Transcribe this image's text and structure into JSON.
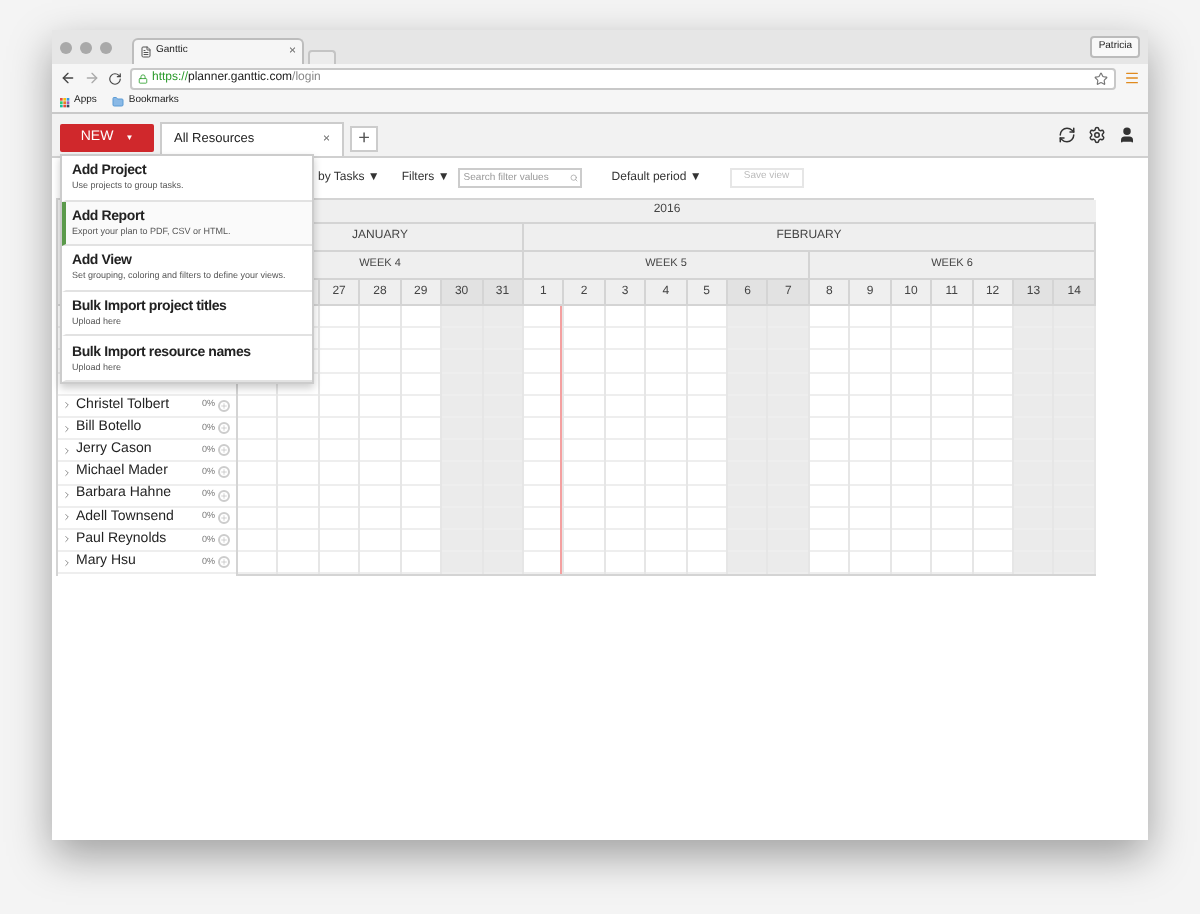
{
  "browser": {
    "tab_title": "Ganttic",
    "tab_close": "×",
    "profile": "Patricia",
    "url_scheme": "https://",
    "url_host": "planner.ganttic.com",
    "url_path": "/login",
    "bookmarks": [
      "Apps",
      "Bookmarks"
    ]
  },
  "toolbar": {
    "new_button": "NEW",
    "new_caret": "▼",
    "view_tab": "All Resources",
    "view_close": "×",
    "add": "+"
  },
  "filters": {
    "group": "by Tasks ▼",
    "filters": "Filters ▼",
    "search_placeholder": "Search filter values",
    "period": "Default period ▼",
    "save": "Save view",
    "save_disabled": true
  },
  "timeline": {
    "year": "2016",
    "months": [
      {
        "label": "JANUARY"
      },
      {
        "label": "FEBRUARY"
      }
    ],
    "weeks": [
      {
        "label": "WEEK 4"
      },
      {
        "label": "WEEK 5"
      },
      {
        "label": "WEEK 6"
      }
    ],
    "days": [
      {
        "label": "27",
        "weekend": false
      },
      {
        "label": "28",
        "weekend": false
      },
      {
        "label": "29",
        "weekend": false
      },
      {
        "label": "30",
        "weekend": true
      },
      {
        "label": "31",
        "weekend": true
      },
      {
        "label": "1",
        "weekend": false
      },
      {
        "label": "2",
        "weekend": false
      },
      {
        "label": "3",
        "weekend": false
      },
      {
        "label": "4",
        "weekend": false
      },
      {
        "label": "5",
        "weekend": false
      },
      {
        "label": "6",
        "weekend": true
      },
      {
        "label": "7",
        "weekend": true
      },
      {
        "label": "8",
        "weekend": false
      },
      {
        "label": "9",
        "weekend": false
      },
      {
        "label": "10",
        "weekend": false
      },
      {
        "label": "11",
        "weekend": false
      },
      {
        "label": "12",
        "weekend": false
      },
      {
        "label": "13",
        "weekend": true
      },
      {
        "label": "14",
        "weekend": true
      }
    ]
  },
  "resources": [
    {
      "name": "Christel Tolbert",
      "load": "0%"
    },
    {
      "name": "Bill Botello",
      "load": "0%"
    },
    {
      "name": "Jerry Cason",
      "load": "0%"
    },
    {
      "name": "Michael Mader",
      "load": "0%"
    },
    {
      "name": "Barbara Hahne",
      "load": "0%"
    },
    {
      "name": "Adell Townsend",
      "load": "0%"
    },
    {
      "name": "Paul Reynolds",
      "load": "0%"
    },
    {
      "name": "Mary Hsu",
      "load": "0%"
    }
  ],
  "new_menu": [
    {
      "title": "Add Project",
      "description": "Use projects to group tasks.",
      "selected": false
    },
    {
      "title": "Add Report",
      "description": "Export your plan to PDF, CSV or HTML.",
      "selected": true
    },
    {
      "title": "Add View",
      "description": "Set grouping, coloring and filters to define your views.",
      "selected": false
    },
    {
      "title": "Bulk Import project titles",
      "description": "Upload here",
      "selected": false
    },
    {
      "title": "Bulk Import resource names",
      "description": "Upload here",
      "selected": false
    }
  ]
}
